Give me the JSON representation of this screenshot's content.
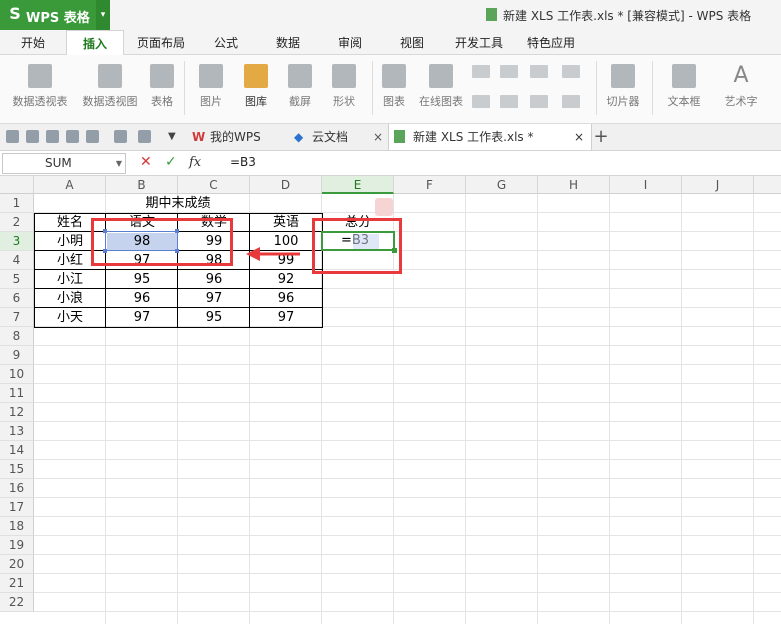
{
  "app": {
    "name": "WPS 表格",
    "window_title": "新建 XLS 工作表.xls * [兼容模式] - WPS 表格"
  },
  "ribbon_tabs": [
    {
      "label": "开始"
    },
    {
      "label": "插入"
    },
    {
      "label": "页面布局"
    },
    {
      "label": "公式"
    },
    {
      "label": "数据"
    },
    {
      "label": "审阅"
    },
    {
      "label": "视图"
    },
    {
      "label": "开发工具"
    },
    {
      "label": "特色应用"
    }
  ],
  "active_tab": "插入",
  "ribbon": {
    "pivot_table": "数据透视表",
    "pivot_chart": "数据透视图",
    "table": "表格",
    "picture": "图片",
    "gallery": "图库",
    "screenshot": "截屏",
    "shapes": "形状",
    "chart": "图表",
    "online_chart": "在线图表",
    "slicer": "切片器",
    "textbox": "文本框",
    "wordart": "艺术字"
  },
  "doc_tabs": {
    "my_wps": "我的WPS",
    "cloud_docs": "云文档",
    "current": "新建 XLS 工作表.xls *"
  },
  "formula_bar": {
    "name_box": "SUM",
    "formula": "=B3",
    "fx": "fx"
  },
  "columns": [
    "A",
    "B",
    "C",
    "D",
    "E",
    "F",
    "G",
    "H",
    "I",
    "J"
  ],
  "rows": [
    "1",
    "2",
    "3",
    "4",
    "5",
    "6",
    "7",
    "8",
    "9",
    "10",
    "11",
    "12",
    "13",
    "14",
    "15",
    "16",
    "17",
    "18",
    "19",
    "20",
    "21",
    "22"
  ],
  "sheet": {
    "title": "期中末成绩",
    "headers": [
      "姓名",
      "语文",
      "数学",
      "英语",
      "总分"
    ],
    "records": [
      {
        "name": "小明",
        "chinese": "98",
        "math": "99",
        "english": "100"
      },
      {
        "name": "小红",
        "chinese": "97",
        "math": "98",
        "english": "99"
      },
      {
        "name": "小江",
        "chinese": "95",
        "math": "96",
        "english": "92"
      },
      {
        "name": "小浪",
        "chinese": "96",
        "math": "97",
        "english": "96"
      },
      {
        "name": "小天",
        "chinese": "97",
        "math": "95",
        "english": "97"
      }
    ],
    "editing_cell": "=B3"
  },
  "colors": {
    "brand_green": "#3a9a3a",
    "annotation_red": "#e83a3a",
    "selection_fill": "#c6d3ee"
  }
}
